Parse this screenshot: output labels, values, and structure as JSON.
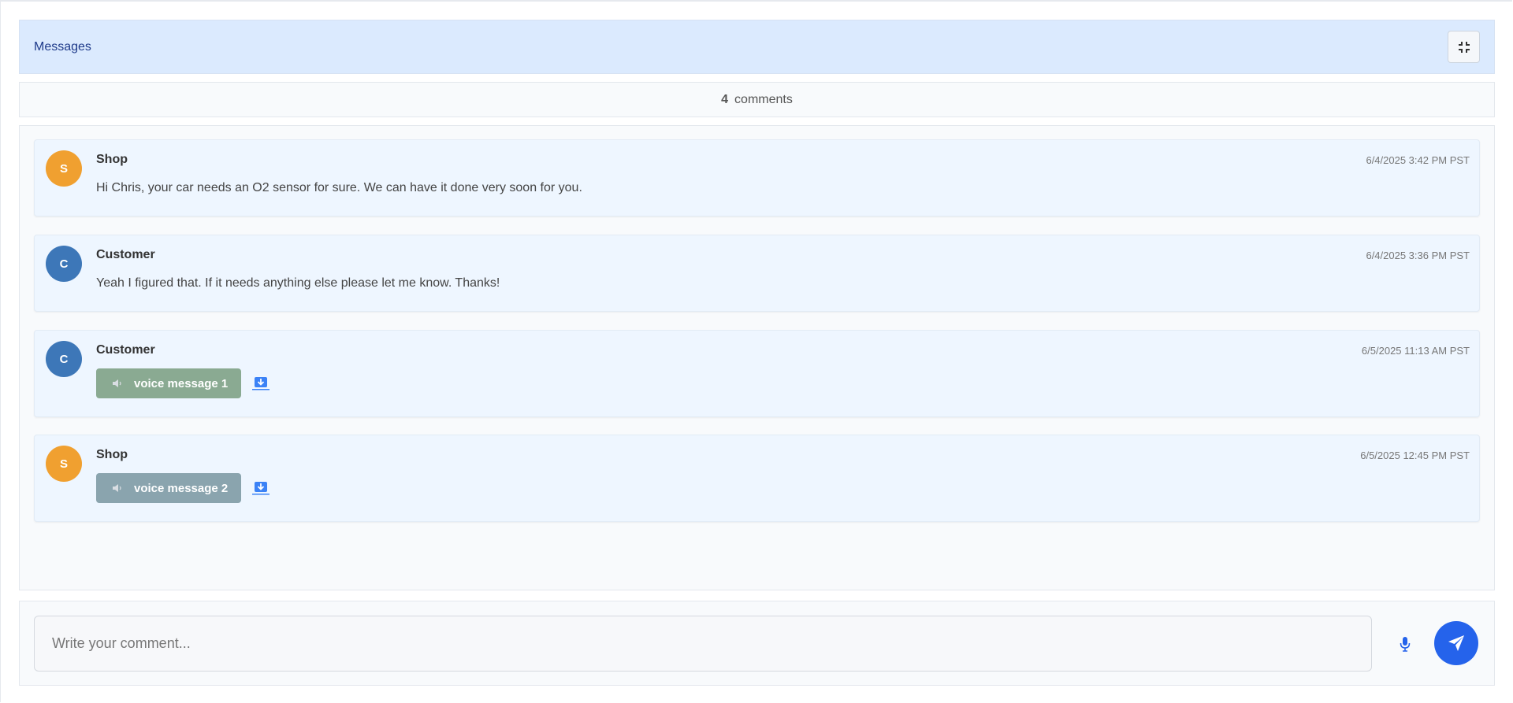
{
  "header": {
    "title": "Messages",
    "collapse_icon": "compress-icon"
  },
  "comment_count": {
    "value": "4",
    "label": "comments"
  },
  "colors": {
    "shop_avatar": "#f0a030",
    "customer_avatar": "#3d77b8",
    "voice_customer": "#8aaa92",
    "voice_shop": "#8aa4ae",
    "send_button": "#2563eb",
    "mic_icon": "#2563eb"
  },
  "messages": [
    {
      "initial": "S",
      "author": "Shop",
      "timestamp": "6/4/2025 3:42 PM PST",
      "text": "Hi Chris, your car needs an O2 sensor for sure. We can have it done very soon for you."
    },
    {
      "initial": "C",
      "author": "Customer",
      "timestamp": "6/4/2025 3:36 PM PST",
      "text": "Yeah I figured that. If it needs anything else please let me know. Thanks!"
    },
    {
      "initial": "C",
      "author": "Customer",
      "timestamp": "6/5/2025 11:13 AM PST",
      "voice_label": "voice message 1"
    },
    {
      "initial": "S",
      "author": "Shop",
      "timestamp": "6/5/2025 12:45 PM PST",
      "voice_label": "voice message 2"
    }
  ],
  "composer": {
    "placeholder": "Write your comment...",
    "mic_icon": "microphone-icon",
    "send_icon": "paper-plane-icon"
  }
}
